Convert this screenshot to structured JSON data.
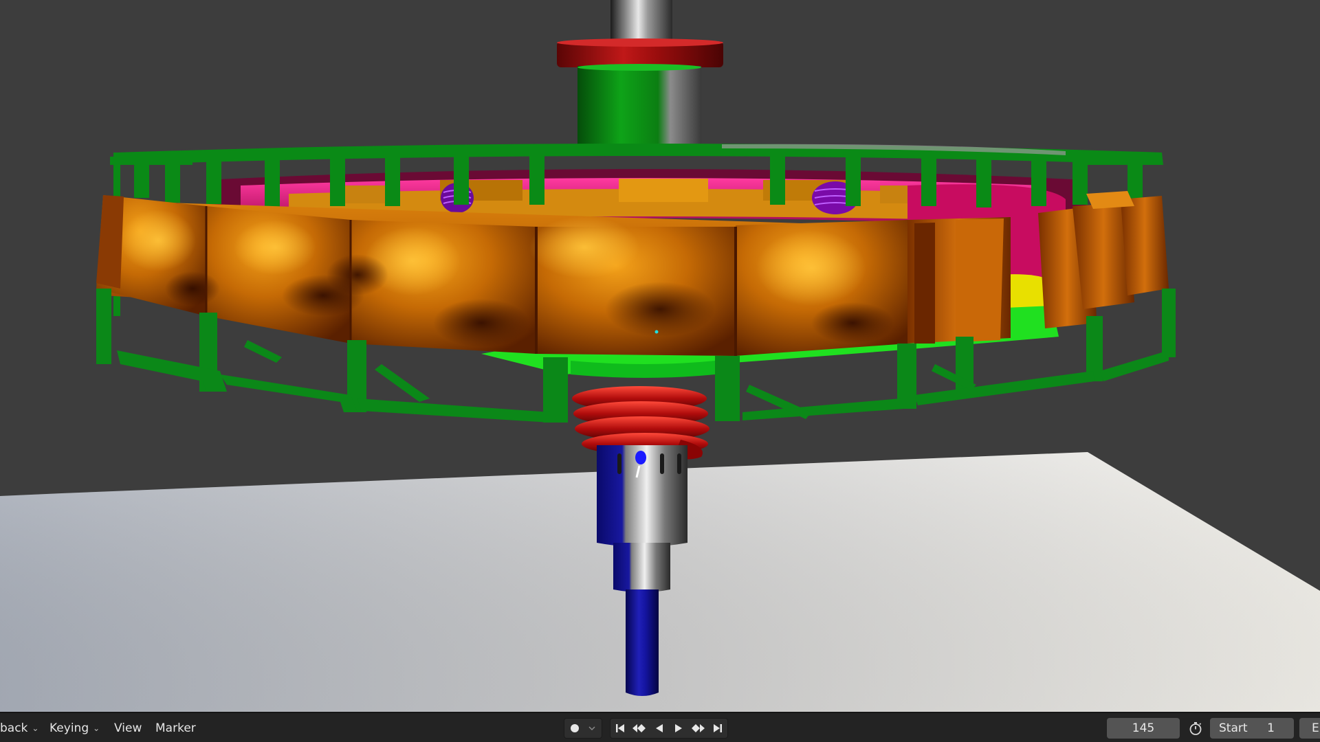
{
  "timeline": {
    "menus": {
      "playback": "back",
      "keying": "Keying",
      "view": "View",
      "marker": "Marker"
    },
    "current_frame": "145",
    "start_label": "Start",
    "start_value": "1",
    "end_label_fragment": "E"
  },
  "icons": {
    "record": "record-icon",
    "jump_start": "jump-to-start-icon",
    "prev_keyframe": "previous-keyframe-icon",
    "play_reverse": "play-reverse-icon",
    "play": "play-icon",
    "next_keyframe": "next-keyframe-icon",
    "jump_end": "jump-to-end-icon",
    "stopwatch": "stopwatch-icon"
  },
  "colors": {
    "background": "#3d3d3d",
    "frame_green": "#0a8a16",
    "coil_orange": "#c86400",
    "ring_magenta": "#d4106a",
    "collar_red": "#a01010",
    "shaft_blue": "#12128a",
    "floor": "#d6d6d6"
  }
}
